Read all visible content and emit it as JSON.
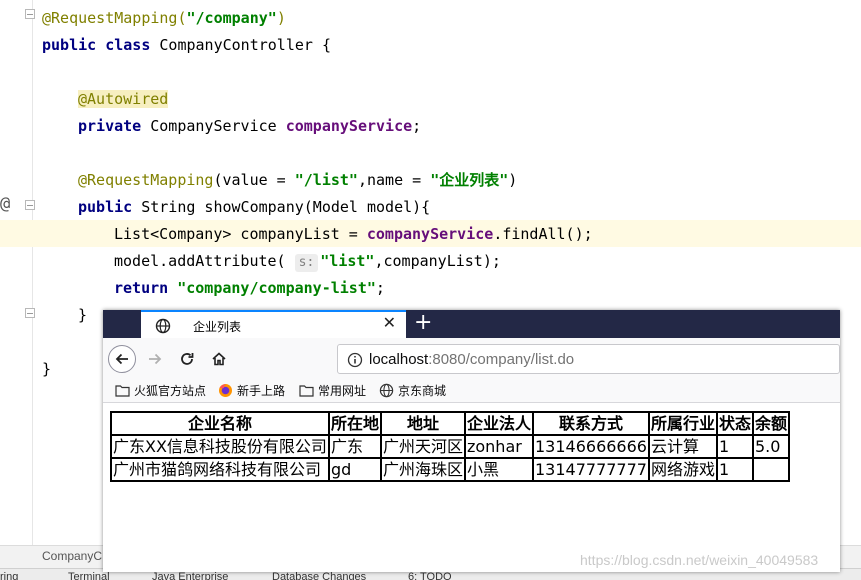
{
  "editor": {
    "lines": [
      {
        "parts": [
          [
            "ann",
            "@RequestMapping("
          ],
          [
            "str",
            "\"/company\""
          ],
          [
            "ann",
            ")"
          ]
        ]
      },
      {
        "parts": [
          [
            "kw",
            "public class "
          ],
          [
            "txt",
            "CompanyController {"
          ]
        ]
      },
      {
        "parts": []
      },
      {
        "parts": [
          [
            "annbg",
            "@Autowired"
          ]
        ]
      },
      {
        "parts": [
          [
            "kw",
            "private "
          ],
          [
            "txt",
            "CompanyService "
          ],
          [
            "fld",
            "companyService"
          ],
          [
            "txt",
            ";"
          ]
        ]
      },
      {
        "parts": []
      },
      {
        "parts": [
          [
            "ann",
            "@RequestMapping"
          ],
          [
            "txt",
            "(value = "
          ],
          [
            "str",
            "\"/list\""
          ],
          [
            "txt",
            ",name = "
          ],
          [
            "str",
            "\"企业列表\""
          ],
          [
            "txt",
            ")"
          ]
        ]
      },
      {
        "parts": [
          [
            "kw",
            "public "
          ],
          [
            "txt",
            "String showCompany(Model model){"
          ]
        ]
      },
      {
        "parts": [
          [
            "txt",
            "List<Company> companyList = "
          ],
          [
            "fld",
            "companyService"
          ],
          [
            "txt",
            ".findAll();"
          ]
        ]
      },
      {
        "parts": [
          [
            "txt",
            "model.addAttribute( "
          ],
          [
            "hint",
            "s:"
          ],
          [
            "str",
            "\"list\""
          ],
          [
            "txt",
            ",companyList);"
          ]
        ]
      },
      {
        "parts": [
          [
            "kw",
            "return "
          ],
          [
            "str",
            "\"company/company-list\""
          ],
          [
            "txt",
            ";"
          ]
        ]
      },
      {
        "parts": [
          [
            "txt",
            "}"
          ]
        ]
      },
      {
        "parts": []
      },
      {
        "parts": [
          [
            "txt",
            "}"
          ]
        ]
      }
    ],
    "breadcrumb": "CompanyC",
    "bottom_tools": [
      "ring",
      "Terminal",
      "Java Enterprise",
      "Database Changes",
      "6: TODO"
    ]
  },
  "browser": {
    "tab_title": "企业列表",
    "url_host": "localhost",
    "url_rest": ":8080/company/list.do",
    "bookmarks": [
      "火狐官方站点",
      "新手上路",
      "常用网址",
      "京东商城"
    ]
  },
  "table": {
    "headers": [
      "企业名称",
      "所在地",
      "地址",
      "企业法人",
      "联系方式",
      "所属行业",
      "状态",
      "余额"
    ],
    "rows": [
      [
        "广东XX信息科技股份有限公司",
        "广东",
        "广州天河区",
        "zonhar",
        "13146666666",
        "云计算",
        "1",
        "5.0"
      ],
      [
        "广州市猫鸽网络科技有限公司",
        "gd",
        "广州海珠区",
        "小黑",
        "13147777777",
        "网络游戏",
        "1",
        ""
      ]
    ]
  },
  "watermark": "https://blog.csdn.net/weixin_40049583",
  "colors": {
    "keyword": "#000080",
    "string": "#008000",
    "annotation": "#808000",
    "field": "#660e7a",
    "tabbar": "#232846",
    "highlight_line": "#fffae3"
  }
}
